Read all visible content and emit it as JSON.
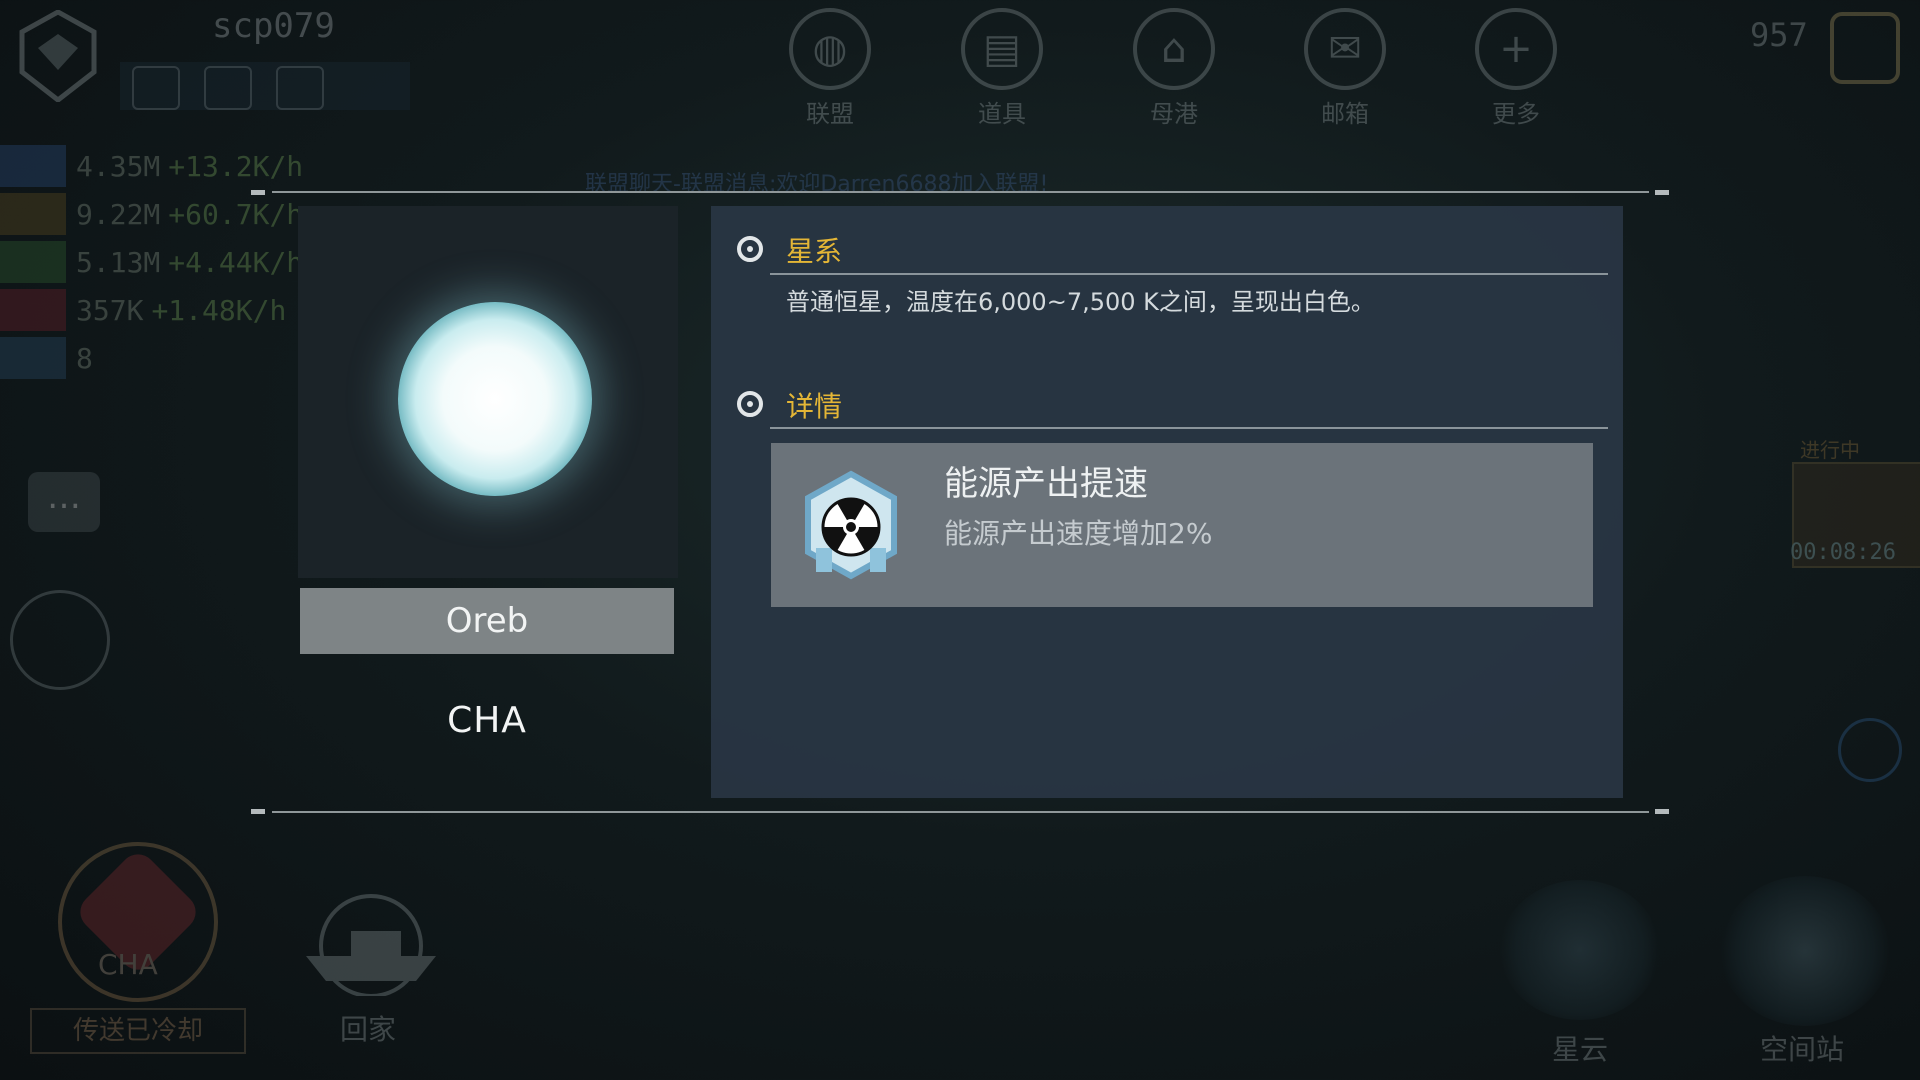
{
  "hud": {
    "player_name": "scp079",
    "resources": [
      {
        "amount": "4.35M",
        "rate": "+13.2K/h",
        "icon": "energy-icon",
        "color": "#2a4a78"
      },
      {
        "amount": "9.22M",
        "rate": "+60.7K/h",
        "icon": "ore-icon",
        "color": "#5a4a20"
      },
      {
        "amount": "5.13M",
        "rate": "+4.44K/h",
        "icon": "crystal-icon",
        "color": "#2f5a2f"
      },
      {
        "amount": "357K",
        "rate": "+1.48K/h",
        "icon": "alloy-icon",
        "color": "#6a1f2a"
      },
      {
        "amount": "8",
        "rate": "",
        "icon": "eye-icon",
        "color": "#2a4a66"
      }
    ],
    "nav": [
      {
        "label": "联盟",
        "icon": "globe-icon"
      },
      {
        "label": "道具",
        "icon": "inventory-icon"
      },
      {
        "label": "母港",
        "icon": "mothership-icon"
      },
      {
        "label": "邮箱",
        "icon": "mail-icon"
      },
      {
        "label": "更多",
        "icon": "plus-icon"
      }
    ],
    "credits": "957",
    "chat_ticker": "联盟聊天-联盟消息:欢迎Darren6688加入联盟!",
    "cha_label": "CHA",
    "cooldown_label": "传送已冷却",
    "home_label": "回家",
    "nebula_label": "星云",
    "station_label": "空间站",
    "in_progress": "进行中",
    "timer": "00:08:26"
  },
  "dialog": {
    "star_name": "Oreb",
    "faction": "CHA",
    "sections": {
      "galaxy": {
        "title": "星系",
        "description": "普通恒星，温度在6,000~7,500 K之间，呈现出白色。"
      },
      "details": {
        "title": "详情",
        "buff": {
          "title": "能源产出提速",
          "description": "能源产出速度增加2%",
          "icon": "radiation-icon"
        }
      }
    }
  },
  "colors": {
    "section_title": "#e4b636",
    "panel_bg": "#283542",
    "buff_card_bg": "#6b737a"
  }
}
